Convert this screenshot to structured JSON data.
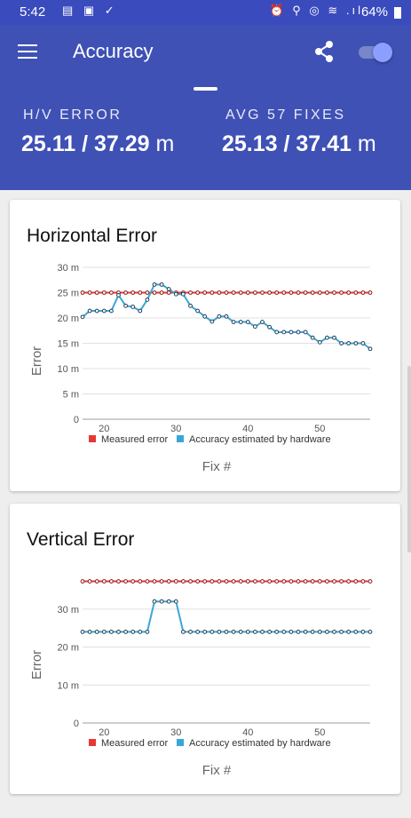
{
  "status_bar": {
    "time": "5:42",
    "left_icons": "▤ ▣ ✓",
    "right_icons": "⏰ ⚲ ◎ ≋ .ıl",
    "battery": "64%"
  },
  "app_bar": {
    "title": "Accuracy"
  },
  "summary": {
    "hv_label": "H/V ERROR",
    "hv_value": "25.11 / 37.29",
    "hv_unit": "m",
    "avg_label": "AVG 57 FIXES",
    "avg_value": "25.13 / 37.41",
    "avg_unit": "m"
  },
  "colors": {
    "primary": "#3f51b5",
    "measured": "#e53935",
    "estimated": "#3aa6d8"
  },
  "chart_data": [
    {
      "type": "line",
      "title": "Horizontal Error",
      "ylabel": "Error",
      "xlabel": "Fix #",
      "xlim": [
        17,
        57
      ],
      "ylim": [
        0,
        30
      ],
      "yticks": [
        0,
        5,
        10,
        15,
        20,
        25,
        30
      ],
      "ytick_labels": [
        "0",
        "5 m",
        "10 m",
        "15 m",
        "20 m",
        "25 m",
        "30 m"
      ],
      "xticks": [
        20,
        30,
        40,
        50
      ],
      "legend": [
        "Measured error",
        "Accuracy estimated by hardware"
      ],
      "legend_position": "bottom",
      "series": [
        {
          "name": "Measured error",
          "x_start": 17,
          "values": [
            25,
            25,
            25,
            25,
            25,
            25,
            25,
            25,
            25,
            25,
            25,
            25,
            25,
            25,
            25,
            25,
            25,
            25,
            25,
            25,
            25,
            25,
            25,
            25,
            25,
            25,
            25,
            25,
            25,
            25,
            25,
            25,
            25,
            25,
            25,
            25,
            25,
            25,
            25,
            25,
            25
          ]
        },
        {
          "name": "Accuracy estimated by hardware",
          "x_start": 17,
          "values": [
            20.2,
            21.4,
            21.4,
            21.4,
            21.4,
            24.5,
            22.4,
            22.2,
            21.4,
            23.6,
            26.6,
            26.6,
            25.7,
            24.7,
            24.7,
            22.4,
            21.4,
            20.3,
            19.3,
            20.3,
            20.3,
            19.2,
            19.2,
            19.2,
            18.3,
            19.2,
            18.2,
            17.2,
            17.2,
            17.2,
            17.2,
            17.2,
            16.1,
            15.2,
            16.1,
            16.1,
            15.0,
            15.0,
            15.0,
            15.0,
            13.9
          ]
        }
      ]
    },
    {
      "type": "line",
      "title": "Vertical Error",
      "ylabel": "Error",
      "xlabel": "Fix #",
      "xlim": [
        17,
        57
      ],
      "ylim": [
        0,
        40
      ],
      "yticks": [
        0,
        10,
        20,
        30
      ],
      "ytick_labels": [
        "0",
        "10 m",
        "20 m",
        "30 m"
      ],
      "xticks": [
        20,
        30,
        40,
        50
      ],
      "legend": [
        "Measured error",
        "Accuracy estimated by hardware"
      ],
      "legend_position": "bottom",
      "series": [
        {
          "name": "Measured error",
          "x_start": 17,
          "values": [
            37.3,
            37.3,
            37.3,
            37.3,
            37.3,
            37.3,
            37.3,
            37.3,
            37.3,
            37.3,
            37.3,
            37.3,
            37.3,
            37.3,
            37.3,
            37.3,
            37.3,
            37.3,
            37.3,
            37.3,
            37.3,
            37.3,
            37.3,
            37.3,
            37.3,
            37.3,
            37.3,
            37.3,
            37.3,
            37.3,
            37.3,
            37.3,
            37.3,
            37.3,
            37.3,
            37.3,
            37.3,
            37.3,
            37.3,
            37.3,
            37.3
          ]
        },
        {
          "name": "Accuracy estimated by hardware",
          "x_start": 17,
          "values": [
            24,
            24,
            24,
            24,
            24,
            24,
            24,
            24,
            24,
            24,
            32,
            32,
            32,
            32,
            24,
            24,
            24,
            24,
            24,
            24,
            24,
            24,
            24,
            24,
            24,
            24,
            24,
            24,
            24,
            24,
            24,
            24,
            24,
            24,
            24,
            24,
            24,
            24,
            24,
            24,
            24
          ]
        }
      ]
    }
  ]
}
